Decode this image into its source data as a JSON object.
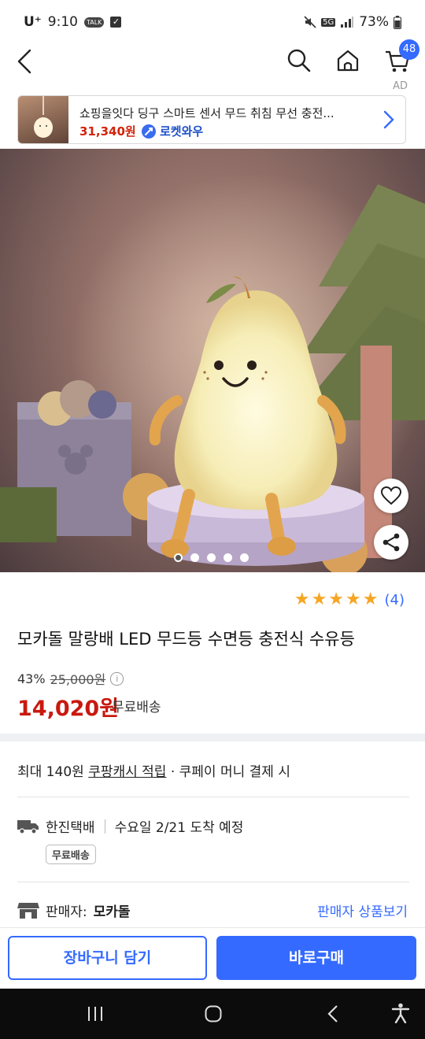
{
  "status": {
    "carrier": "U⁺",
    "time": "9:10",
    "talk_chip": "TALK",
    "network": "5G",
    "battery": "73%"
  },
  "nav": {
    "cart_count": "48",
    "ad_label": "AD"
  },
  "ad_banner": {
    "title": "쇼핑을잇다 딩구 스마트 센서 무드 취침 무선 충전...",
    "price": "31,340원",
    "badge": "로켓와우"
  },
  "gallery": {
    "slide_count": 5,
    "active_slide": 1
  },
  "product": {
    "rating": 5,
    "review_count": "(4)",
    "name": "모카돌 말랑배 LED 무드등 수면등 충전식 수유등",
    "discount": "43%",
    "original_price": "25,000원",
    "info_icon": "i",
    "price": "14,020원",
    "shipping": "무료배송"
  },
  "cash": {
    "prefix": "최대 140원 ",
    "link": "쿠팡캐시 적립",
    "suffix": " · 쿠페이 머니 결제 시"
  },
  "delivery": {
    "carrier": "한진택배",
    "arrival": "수요일 2/21 도착 예정",
    "tag": "무료배송"
  },
  "seller": {
    "label": "판매자: ",
    "name": "모카돌",
    "link": "판매자 상품보기"
  },
  "actions": {
    "cart": "장바구니 담기",
    "buy": "바로구매"
  },
  "colors": {
    "accent": "#346aff",
    "price_red": "#c8190f",
    "star": "#f5a623"
  }
}
